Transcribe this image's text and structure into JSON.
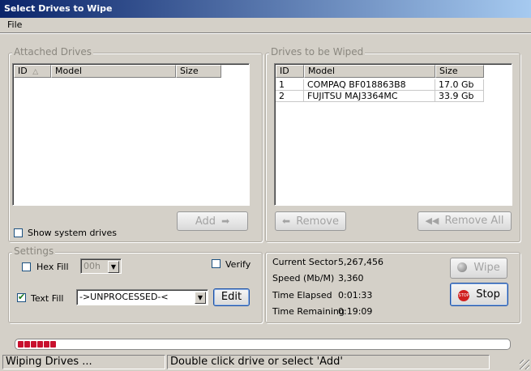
{
  "window": {
    "title": "Select Drives to Wipe"
  },
  "menu": {
    "file": "File"
  },
  "attached": {
    "legend": "Attached Drives",
    "columns": [
      "ID",
      "Model",
      "Size"
    ],
    "show_system_label": "Show system drives",
    "add_label": "Add"
  },
  "wipe_list": {
    "legend": "Drives to be Wiped",
    "columns": [
      "ID",
      "Model",
      "Size"
    ],
    "rows": [
      {
        "id": "1",
        "model": "COMPAQ BF018863B8",
        "size": "17.0 Gb"
      },
      {
        "id": "2",
        "model": "FUJITSU MAJ3364MC",
        "size": "33.9 Gb"
      }
    ],
    "remove_label": "Remove",
    "remove_all_label": "Remove All"
  },
  "settings": {
    "legend": "Settings",
    "hex_fill_label": "Hex Fill",
    "hex_value": "00h",
    "verify_label": "Verify",
    "text_fill_label": "Text Fill",
    "text_value": "->UNPROCESSED-<",
    "edit_label": "Edit"
  },
  "stats": {
    "current_sector_label": "Current Sector",
    "current_sector": "5,267,456",
    "speed_label": "Speed (Mb/M)",
    "speed": "3,360",
    "elapsed_label": "Time Elapsed",
    "elapsed": "0:01:33",
    "remaining_label": "Time Remaining",
    "remaining": "0:19:09"
  },
  "actions": {
    "wipe_label": "Wipe",
    "stop_label": "Stop",
    "stop_badge": "STOP"
  },
  "progress": {
    "segments": 6
  },
  "statusbar": {
    "left": "Wiping Drives ...",
    "right": "Double click drive or select 'Add'"
  }
}
